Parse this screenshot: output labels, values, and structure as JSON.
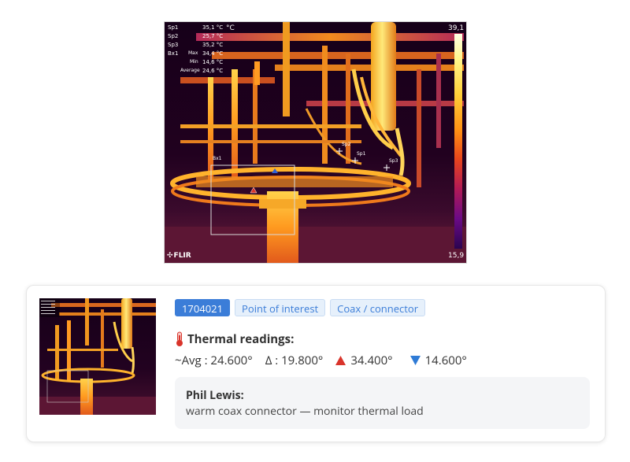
{
  "thermal_image": {
    "readout_unit": "°C",
    "measurements": [
      {
        "label": "Sp1",
        "value": "35,1 °C"
      },
      {
        "label": "Sp2",
        "value": "25,7 °C"
      },
      {
        "label": "Sp3",
        "value": "35,2 °C"
      },
      {
        "label": "Bx1",
        "stat": "Max",
        "value": "34,4 °C"
      },
      {
        "label": "",
        "stat": "Min",
        "value": "14,6 °C"
      },
      {
        "label": "",
        "stat": "Average",
        "value": "24,6 °C"
      }
    ],
    "scale_max": "39,1",
    "scale_min": "15,9",
    "spot_labels": [
      "Sp1",
      "Sp2",
      "Sp3"
    ],
    "box_label": "Bx1",
    "brand": "FLIR"
  },
  "card": {
    "tags": [
      "1704021",
      "Point of interest",
      "Coax / connector"
    ],
    "heading": "Thermal readings:",
    "stats": {
      "avg": "~Avg : 24.600°",
      "delta": "Δ : 19.800°",
      "max": "34.400°",
      "min": "14.600°"
    },
    "comment": {
      "author": "Phil Lewis:",
      "text": "warm coax connector — monitor thermal load"
    }
  },
  "colors": {
    "accent": "#3b7dd8",
    "max_marker": "#d9342b",
    "min_marker": "#2f7bd6",
    "thermometer": "#d9342b"
  }
}
